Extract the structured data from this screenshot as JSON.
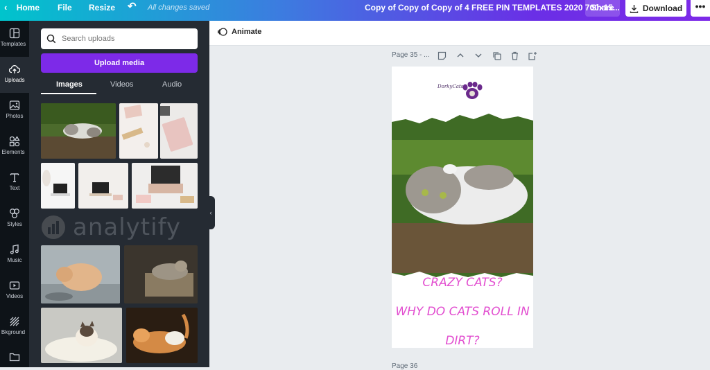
{
  "topbar": {
    "home": "Home",
    "file": "File",
    "resize": "Resize",
    "saved_status": "All changes saved",
    "doc_title": "Copy of Copy of Copy of 4 FREE PIN TEMPLATES 2020 700x15...",
    "share": "Share",
    "download": "Download",
    "more": "•••"
  },
  "rail": {
    "items": [
      {
        "label": "Templates",
        "icon": "templates-icon"
      },
      {
        "label": "Uploads",
        "icon": "upload-icon"
      },
      {
        "label": "Photos",
        "icon": "photos-icon"
      },
      {
        "label": "Elements",
        "icon": "elements-icon"
      },
      {
        "label": "Text",
        "icon": "text-icon"
      },
      {
        "label": "Styles",
        "icon": "styles-icon"
      },
      {
        "label": "Music",
        "icon": "music-icon"
      },
      {
        "label": "Videos",
        "icon": "videos-icon"
      },
      {
        "label": "Bkground",
        "icon": "background-icon"
      }
    ]
  },
  "panel": {
    "search_placeholder": "Search uploads",
    "upload_button": "Upload media",
    "tabs": [
      "Images",
      "Videos",
      "Audio"
    ],
    "watermark": "analytify"
  },
  "toolbar": {
    "animate": "Animate"
  },
  "canvas": {
    "page_label": "Page 35 - ...",
    "next_page_label": "Page 36",
    "brand": "DorkyCats",
    "headline_1": "CRAZY CATS?",
    "headline_2": "WHY DO CATS ROLL IN",
    "headline_3": "DIRT?"
  },
  "colors": {
    "accent": "#7d2ae8",
    "headline": "#e24fd0",
    "panel": "#252b33",
    "rail": "#0e1318"
  }
}
